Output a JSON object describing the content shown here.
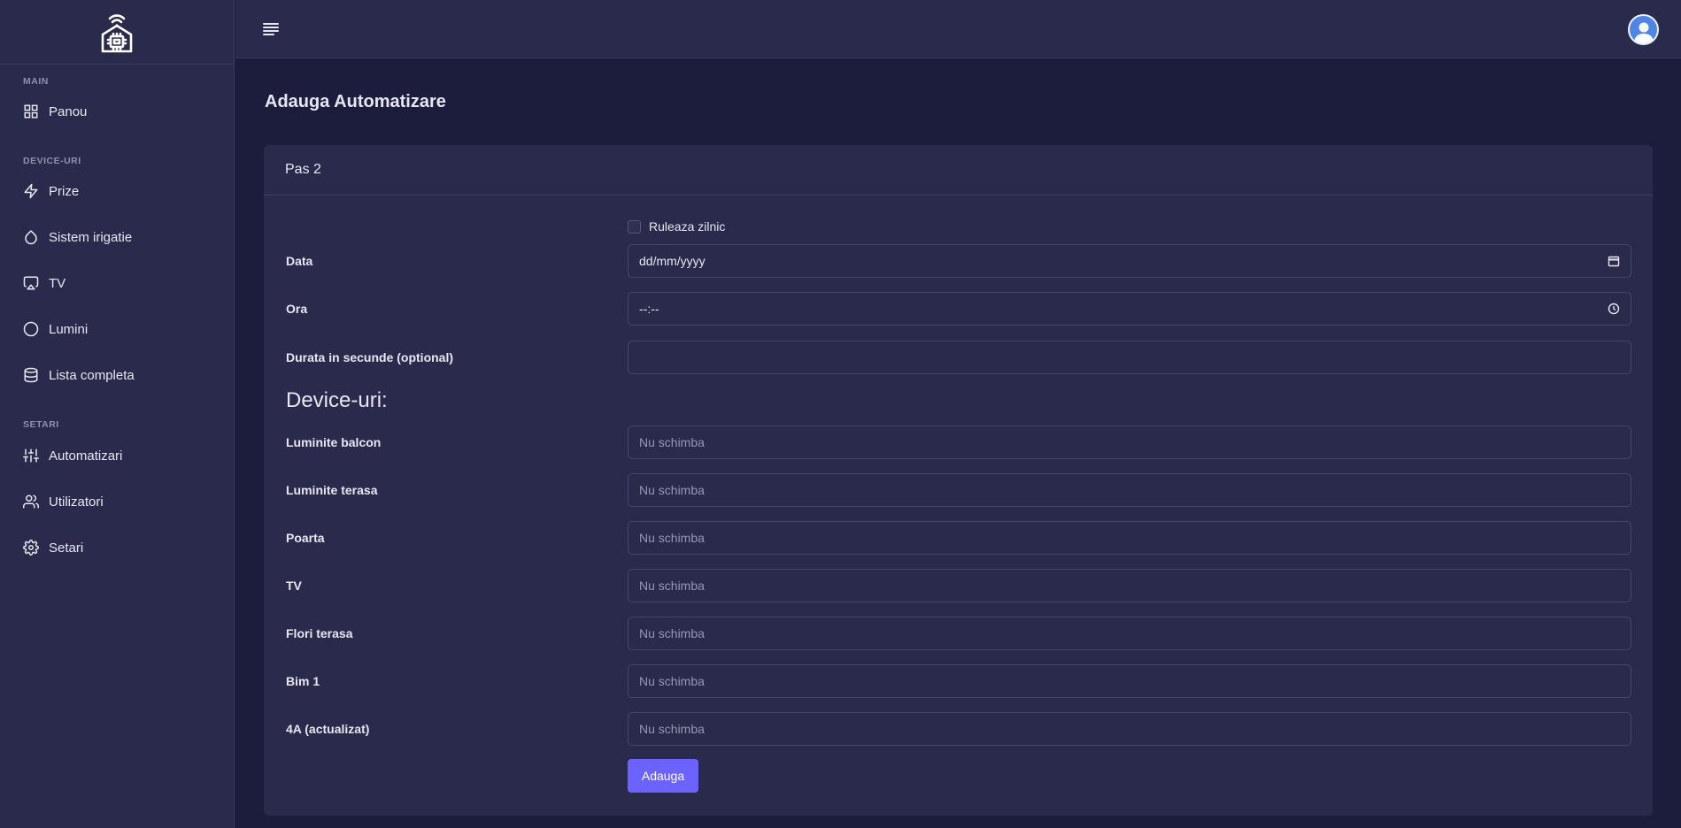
{
  "sidebar": {
    "sections": [
      {
        "title": "MAIN",
        "items": [
          {
            "label": "Panou",
            "icon": "grid-icon"
          }
        ]
      },
      {
        "title": "DEVICE-URI",
        "items": [
          {
            "label": "Prize",
            "icon": "bolt-icon"
          },
          {
            "label": "Sistem irigatie",
            "icon": "droplet-icon"
          },
          {
            "label": "TV",
            "icon": "tv-icon"
          },
          {
            "label": "Lumini",
            "icon": "circle-icon"
          },
          {
            "label": "Lista completa",
            "icon": "database-icon"
          }
        ]
      },
      {
        "title": "SETARI",
        "items": [
          {
            "label": "Automatizari",
            "icon": "sliders-icon"
          },
          {
            "label": "Utilizatori",
            "icon": "users-icon"
          },
          {
            "label": "Setari",
            "icon": "gear-icon"
          }
        ]
      }
    ]
  },
  "page": {
    "title": "Adauga Automatizare",
    "card_title": "Pas 2",
    "daily_checkbox": "Ruleaza zilnic",
    "fields": {
      "date": {
        "label": "Data",
        "value": "dd/mm/yyyy"
      },
      "time": {
        "label": "Ora",
        "value": "--:--"
      },
      "duration": {
        "label": "Durata in secunde (optional)",
        "value": ""
      }
    },
    "devices_heading": "Device-uri:",
    "devices": [
      {
        "label": "Luminite balcon",
        "value": "Nu schimba"
      },
      {
        "label": "Luminite terasa",
        "value": "Nu schimba"
      },
      {
        "label": "Poarta",
        "value": "Nu schimba"
      },
      {
        "label": "TV",
        "value": "Nu schimba"
      },
      {
        "label": "Flori terasa",
        "value": "Nu schimba"
      },
      {
        "label": "Bim 1",
        "value": "Nu schimba"
      },
      {
        "label": "4A (actualizat)",
        "value": "Nu schimba"
      }
    ],
    "submit_label": "Adauga"
  },
  "colors": {
    "accent": "#6c63ff",
    "avatar": "#4f86e6",
    "background": "#1c1d3c",
    "panel": "#2a2b4c"
  }
}
